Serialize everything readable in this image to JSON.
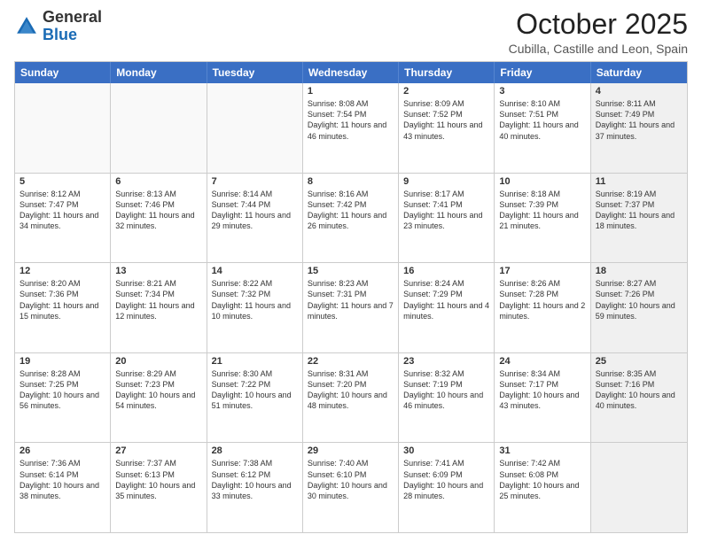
{
  "logo": {
    "general": "General",
    "blue": "Blue"
  },
  "header": {
    "month": "October 2025",
    "location": "Cubilla, Castille and Leon, Spain"
  },
  "weekdays": [
    "Sunday",
    "Monday",
    "Tuesday",
    "Wednesday",
    "Thursday",
    "Friday",
    "Saturday"
  ],
  "rows": [
    [
      {
        "day": "",
        "empty": true
      },
      {
        "day": "",
        "empty": true
      },
      {
        "day": "",
        "empty": true
      },
      {
        "day": "1",
        "sunrise": "8:08 AM",
        "sunset": "7:54 PM",
        "daylight": "11 hours and 46 minutes."
      },
      {
        "day": "2",
        "sunrise": "8:09 AM",
        "sunset": "7:52 PM",
        "daylight": "11 hours and 43 minutes."
      },
      {
        "day": "3",
        "sunrise": "8:10 AM",
        "sunset": "7:51 PM",
        "daylight": "11 hours and 40 minutes."
      },
      {
        "day": "4",
        "sunrise": "8:11 AM",
        "sunset": "7:49 PM",
        "daylight": "11 hours and 37 minutes.",
        "shaded": true
      }
    ],
    [
      {
        "day": "5",
        "sunrise": "8:12 AM",
        "sunset": "7:47 PM",
        "daylight": "11 hours and 34 minutes."
      },
      {
        "day": "6",
        "sunrise": "8:13 AM",
        "sunset": "7:46 PM",
        "daylight": "11 hours and 32 minutes."
      },
      {
        "day": "7",
        "sunrise": "8:14 AM",
        "sunset": "7:44 PM",
        "daylight": "11 hours and 29 minutes."
      },
      {
        "day": "8",
        "sunrise": "8:16 AM",
        "sunset": "7:42 PM",
        "daylight": "11 hours and 26 minutes."
      },
      {
        "day": "9",
        "sunrise": "8:17 AM",
        "sunset": "7:41 PM",
        "daylight": "11 hours and 23 minutes."
      },
      {
        "day": "10",
        "sunrise": "8:18 AM",
        "sunset": "7:39 PM",
        "daylight": "11 hours and 21 minutes."
      },
      {
        "day": "11",
        "sunrise": "8:19 AM",
        "sunset": "7:37 PM",
        "daylight": "11 hours and 18 minutes.",
        "shaded": true
      }
    ],
    [
      {
        "day": "12",
        "sunrise": "8:20 AM",
        "sunset": "7:36 PM",
        "daylight": "11 hours and 15 minutes."
      },
      {
        "day": "13",
        "sunrise": "8:21 AM",
        "sunset": "7:34 PM",
        "daylight": "11 hours and 12 minutes."
      },
      {
        "day": "14",
        "sunrise": "8:22 AM",
        "sunset": "7:32 PM",
        "daylight": "11 hours and 10 minutes."
      },
      {
        "day": "15",
        "sunrise": "8:23 AM",
        "sunset": "7:31 PM",
        "daylight": "11 hours and 7 minutes."
      },
      {
        "day": "16",
        "sunrise": "8:24 AM",
        "sunset": "7:29 PM",
        "daylight": "11 hours and 4 minutes."
      },
      {
        "day": "17",
        "sunrise": "8:26 AM",
        "sunset": "7:28 PM",
        "daylight": "11 hours and 2 minutes."
      },
      {
        "day": "18",
        "sunrise": "8:27 AM",
        "sunset": "7:26 PM",
        "daylight": "10 hours and 59 minutes.",
        "shaded": true
      }
    ],
    [
      {
        "day": "19",
        "sunrise": "8:28 AM",
        "sunset": "7:25 PM",
        "daylight": "10 hours and 56 minutes."
      },
      {
        "day": "20",
        "sunrise": "8:29 AM",
        "sunset": "7:23 PM",
        "daylight": "10 hours and 54 minutes."
      },
      {
        "day": "21",
        "sunrise": "8:30 AM",
        "sunset": "7:22 PM",
        "daylight": "10 hours and 51 minutes."
      },
      {
        "day": "22",
        "sunrise": "8:31 AM",
        "sunset": "7:20 PM",
        "daylight": "10 hours and 48 minutes."
      },
      {
        "day": "23",
        "sunrise": "8:32 AM",
        "sunset": "7:19 PM",
        "daylight": "10 hours and 46 minutes."
      },
      {
        "day": "24",
        "sunrise": "8:34 AM",
        "sunset": "7:17 PM",
        "daylight": "10 hours and 43 minutes."
      },
      {
        "day": "25",
        "sunrise": "8:35 AM",
        "sunset": "7:16 PM",
        "daylight": "10 hours and 40 minutes.",
        "shaded": true
      }
    ],
    [
      {
        "day": "26",
        "sunrise": "7:36 AM",
        "sunset": "6:14 PM",
        "daylight": "10 hours and 38 minutes."
      },
      {
        "day": "27",
        "sunrise": "7:37 AM",
        "sunset": "6:13 PM",
        "daylight": "10 hours and 35 minutes."
      },
      {
        "day": "28",
        "sunrise": "7:38 AM",
        "sunset": "6:12 PM",
        "daylight": "10 hours and 33 minutes."
      },
      {
        "day": "29",
        "sunrise": "7:40 AM",
        "sunset": "6:10 PM",
        "daylight": "10 hours and 30 minutes."
      },
      {
        "day": "30",
        "sunrise": "7:41 AM",
        "sunset": "6:09 PM",
        "daylight": "10 hours and 28 minutes."
      },
      {
        "day": "31",
        "sunrise": "7:42 AM",
        "sunset": "6:08 PM",
        "daylight": "10 hours and 25 minutes."
      },
      {
        "day": "",
        "empty": true,
        "shaded": true
      }
    ]
  ]
}
